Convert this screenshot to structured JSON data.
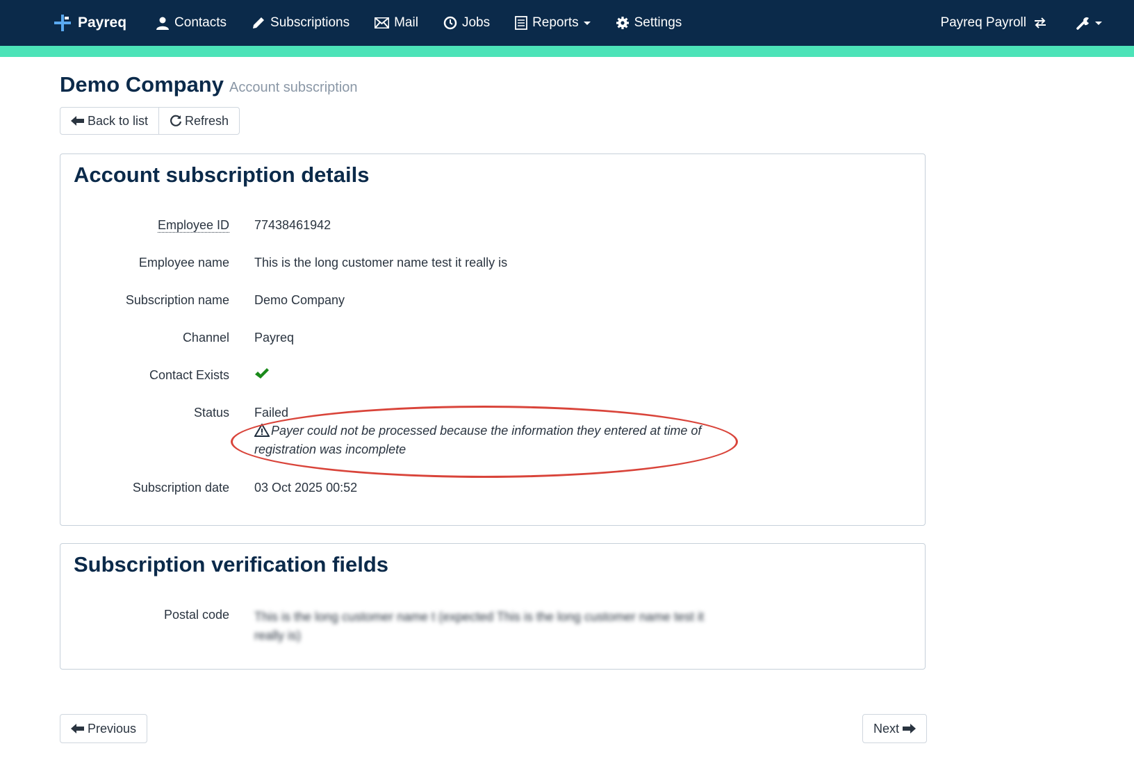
{
  "nav": {
    "brand": "Payreq",
    "items": [
      {
        "label": "Contacts",
        "icon": "user-icon"
      },
      {
        "label": "Subscriptions",
        "icon": "pencil-icon"
      },
      {
        "label": "Mail",
        "icon": "envelope-icon"
      },
      {
        "label": "Jobs",
        "icon": "clock-icon"
      },
      {
        "label": "Reports",
        "icon": "list-icon",
        "dropdown": true
      },
      {
        "label": "Settings",
        "icon": "gear-icon"
      }
    ],
    "org_switcher": "Payreq Payroll",
    "tools_icon": "wrench-icon"
  },
  "colors": {
    "navbar": "#0b2a4a",
    "accent": "#4ce3b8",
    "annotation": "#d9443a",
    "check": "#1a8a1a"
  },
  "header": {
    "title": "Demo Company",
    "subtitle": "Account subscription",
    "back_label": "Back to list",
    "refresh_label": "Refresh"
  },
  "details": {
    "heading": "Account subscription details",
    "employee_id_label": "Employee ID",
    "employee_id": "77438461942",
    "employee_name_label": "Employee name",
    "employee_name": "This is the long customer name test it really is",
    "subscription_name_label": "Subscription name",
    "subscription_name": "Demo Company",
    "channel_label": "Channel",
    "channel": "Payreq",
    "contact_exists_label": "Contact Exists",
    "contact_exists": true,
    "status_label": "Status",
    "status": "Failed",
    "status_message": "Payer could not be processed because the information they entered at time of registration was incomplete",
    "subscription_date_label": "Subscription date",
    "subscription_date": "03 Oct 2025 00:52"
  },
  "verification": {
    "heading": "Subscription verification fields",
    "postal_code_label": "Postal code",
    "postal_code_value": "This is the long customer name t (expected This is the long customer name test it really is)"
  },
  "pager": {
    "previous_label": "Previous",
    "next_label": "Next"
  }
}
